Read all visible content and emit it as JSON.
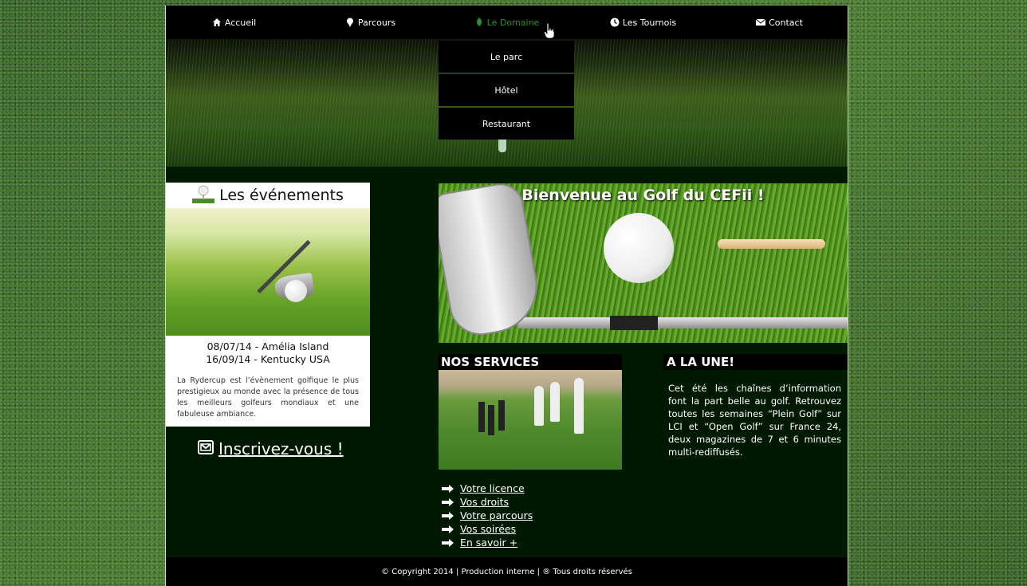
{
  "nav": {
    "items": [
      {
        "label": "Accueil",
        "icon": "home-icon"
      },
      {
        "label": "Parcours",
        "icon": "map-marker-icon"
      },
      {
        "label": "Le Domaine",
        "icon": "leaf-icon",
        "active": true
      },
      {
        "label": "Les Tournois",
        "icon": "clock-icon"
      },
      {
        "label": "Contact",
        "icon": "envelope-icon"
      }
    ],
    "active_color": "#2f8f2f"
  },
  "dropdown": {
    "items": [
      "Le parc",
      "Hôtel",
      "Restaurant"
    ]
  },
  "events": {
    "title": "Les événements",
    "date1": "08/07/14 - Amélia Island",
    "date2": "16/09/14 - Kentucky USA",
    "text": "La Rydercup est l’évènement golfique le plus prestigieux au monde avec la présence de tous les meilleurs golfeurs mondiaux et une fabuleuse ambiance."
  },
  "signup": {
    "label": "Inscrivez-vous !"
  },
  "hero": {
    "title": "Bienvenue au Golf du CEFii !"
  },
  "services": {
    "heading": "NOS SERVICES",
    "links": [
      "Votre licence",
      "Vos droits",
      "Votre parcours",
      "Vos soirées",
      "En savoir +"
    ]
  },
  "une": {
    "heading": "A LA UNE!",
    "text": "Cet été les chaînes d’information font la part belle au golf. Retrouvez toutes les semaines “Plein Golf” sur LCI et “Open Golf” sur France 24, deux magazines de 7 et 6 minutes multi-rediffusés."
  },
  "footer": {
    "text": "© Copyright 2014 | Production interne | ® Tous droits réservés"
  }
}
